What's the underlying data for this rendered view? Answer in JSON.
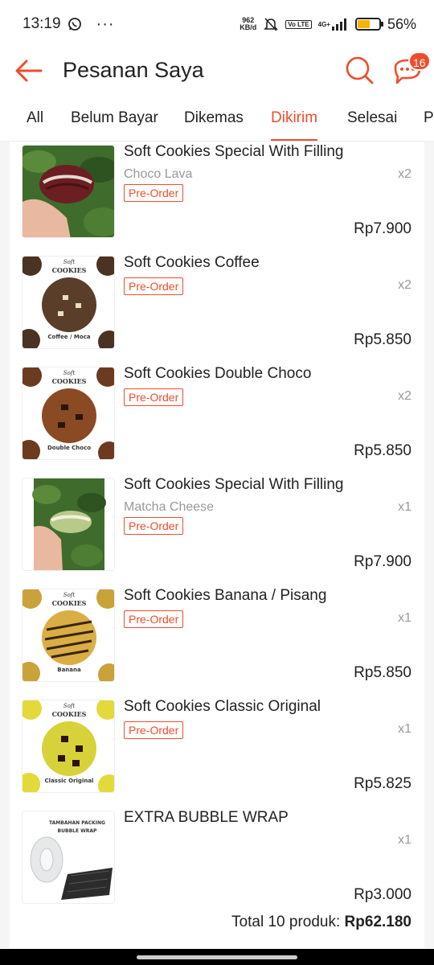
{
  "statusbar": {
    "time": "13:19",
    "dots": "···",
    "net_speed_top": "962",
    "net_speed_bottom": "KB/d",
    "lte": "Vo LTE",
    "network": "4G+",
    "battery_pct": "56%",
    "battery_level": 0.56
  },
  "header": {
    "title": "Pesanan Saya",
    "chat_badge": "16"
  },
  "tabs": [
    {
      "label": "All"
    },
    {
      "label": "Belum Bayar"
    },
    {
      "label": "Dikemas"
    },
    {
      "label": "Dikirim"
    },
    {
      "label": "Selesai"
    },
    {
      "label": "P"
    }
  ],
  "items": [
    {
      "name": "Soft Cookies Special With Filling",
      "variant": "Choco Lava",
      "tag": "Pre-Order",
      "qty": "x2",
      "price": "Rp7.900",
      "thumb": "choco-lava-photo"
    },
    {
      "name": "Soft Cookies Coffee",
      "variant": "",
      "tag": "Pre-Order",
      "qty": "x2",
      "price": "Rp5.850",
      "thumb": "coffee-cookie",
      "thumb_brand": "Soft",
      "thumb_title": "COOKIES",
      "thumb_caption": "Coffee / Moca"
    },
    {
      "name": "Soft Cookies Double Choco",
      "variant": "",
      "tag": "Pre-Order",
      "qty": "x2",
      "price": "Rp5.850",
      "thumb": "double-choco-cookie",
      "thumb_brand": "Soft",
      "thumb_title": "COOKIES",
      "thumb_caption": "Double Choco"
    },
    {
      "name": "Soft Cookies Special With Filling",
      "variant": "Matcha Cheese",
      "tag": "Pre-Order",
      "qty": "x1",
      "price": "Rp7.900",
      "thumb": "matcha-cheese-photo"
    },
    {
      "name": "Soft Cookies Banana / Pisang",
      "variant": "",
      "tag": "Pre-Order",
      "qty": "x1",
      "price": "Rp5.850",
      "thumb": "banana-cookie",
      "thumb_brand": "Soft",
      "thumb_title": "COOKIES",
      "thumb_caption": "Banana"
    },
    {
      "name": "Soft Cookies Classic Original",
      "variant": "",
      "tag": "Pre-Order",
      "qty": "x1",
      "price": "Rp5.825",
      "thumb": "classic-cookie",
      "thumb_brand": "Soft",
      "thumb_title": "COOKIES",
      "thumb_caption": "Classic Original"
    },
    {
      "name": "EXTRA BUBBLE WRAP",
      "variant": "",
      "tag": "",
      "qty": "x1",
      "price": "Rp3.000",
      "thumb": "bubble-wrap",
      "thumb_title": "TAMBAHAN PACKING",
      "thumb_subtitle": "BUBBLE WRAP"
    }
  ],
  "total": {
    "label": "Total 10 produk:",
    "value": "Rp62.180"
  },
  "colors": {
    "accent": "#ee4d2d"
  }
}
